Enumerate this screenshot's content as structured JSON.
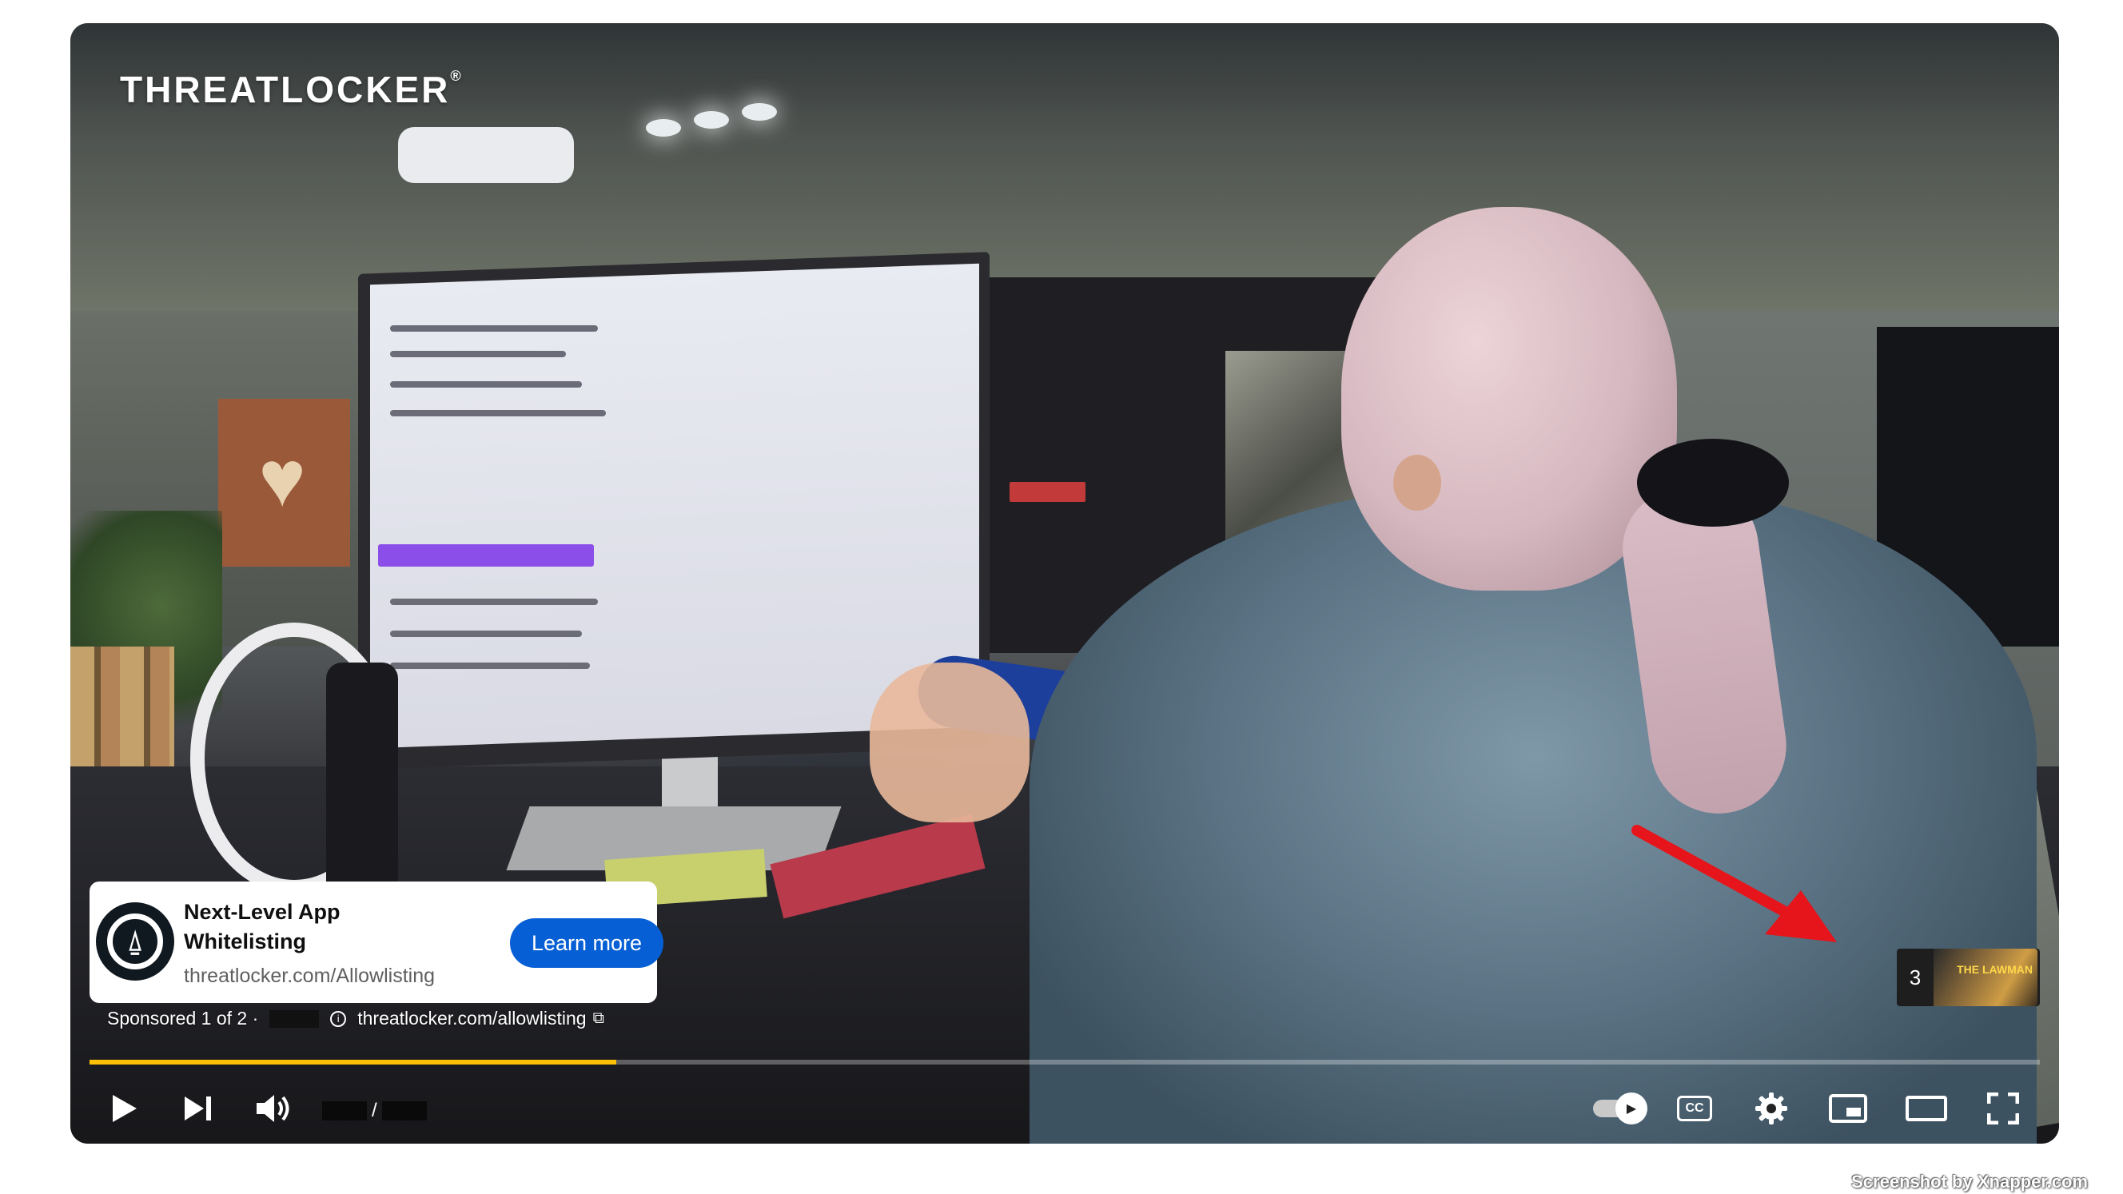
{
  "video": {
    "brand_logo": "THREATLOCKER",
    "brand_mark": "®"
  },
  "ad": {
    "title": "Next-Level App Whitelisting",
    "url": "threatlocker.com/Allowlisting",
    "cta_label": "Learn more",
    "logo_icon": "threatlocker-lock-icon"
  },
  "sponsor": {
    "label": "Sponsored 1 of 2 ·",
    "info_icon": "info-icon",
    "link_text": "threatlocker.com/allowlisting",
    "link_icon": "external-link-icon"
  },
  "next_chip": {
    "count": "3",
    "thumb_text": "THE LAWMAN"
  },
  "player": {
    "progress_fraction": 0.27,
    "time_separator": "/",
    "progress_color": "#ffc107",
    "accent_blue": "#065fd4"
  },
  "controls": {
    "play_icon": "play-icon",
    "next_icon": "next-icon",
    "volume_icon": "volume-icon",
    "autoplay_icon": "autoplay-toggle-icon",
    "cc_label": "CC",
    "settings_icon": "gear-icon",
    "miniplayer_icon": "miniplayer-icon",
    "theater_icon": "theater-mode-icon",
    "fullscreen_icon": "fullscreen-icon"
  },
  "watermark": "Screenshot by Xnapper.com"
}
